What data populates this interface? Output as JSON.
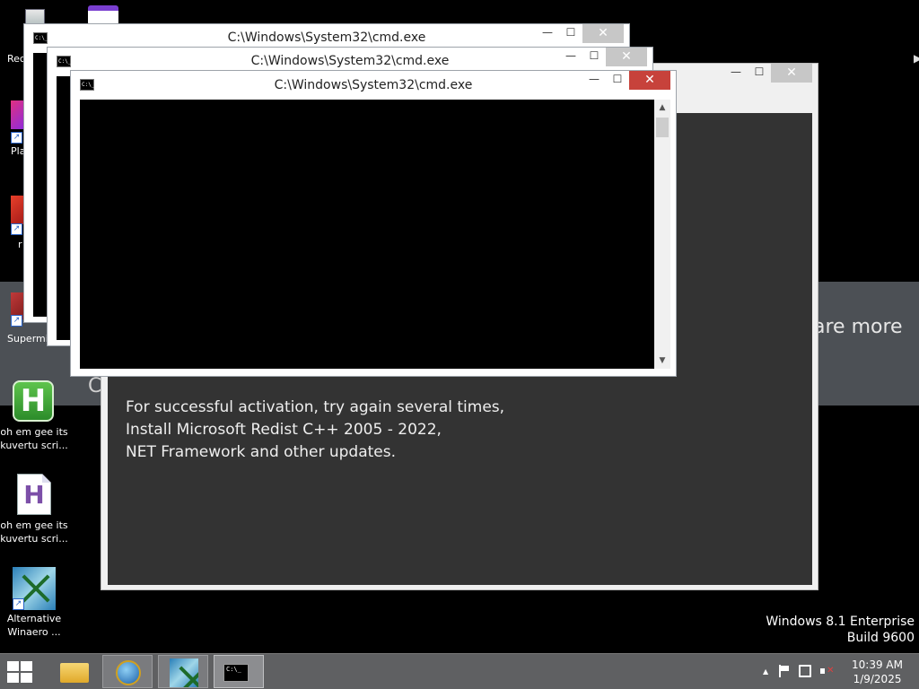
{
  "desktop": {
    "icons": [
      {
        "label": "Rec",
        "icon": "recycle-bin-icon"
      },
      {
        "label": "Pla",
        "icon": "app-shortcut-icon"
      },
      {
        "label": "r",
        "icon": "app-shortcut-icon"
      },
      {
        "label": "Supermi",
        "icon": "app-shortcut-icon"
      },
      {
        "label": "oh em gee its kuvertu scri...",
        "icon": "autohotkey-script-icon"
      },
      {
        "label": "oh em gee its kuvertu scri...",
        "icon": "script-file-icon"
      },
      {
        "label": "Alternative Winaero ...",
        "icon": "winaero-shortcut-icon"
      }
    ],
    "banner_text": "are more",
    "banner_partial": "C"
  },
  "activation_window": {
    "lines": [
      "For successful activation, try again several times,",
      "Install Microsoft Redist C++ 2005 - 2022,",
      "NET Framework and other updates."
    ],
    "background_color": "#333333"
  },
  "cmd_windows": [
    {
      "title": "C:\\Windows\\System32\\cmd.exe"
    },
    {
      "title": "C:\\Windows\\System32\\cmd.exe"
    },
    {
      "title": "C:\\Windows\\System32\\cmd.exe"
    }
  ],
  "window_controls": {
    "minimize": "—",
    "maximize": "☐",
    "close": "✕"
  },
  "watermark": {
    "line1": "Windows 8.1 Enterprise",
    "line2": "Build 9600"
  },
  "taskbar": {
    "items": [
      {
        "name": "file-explorer",
        "icon": "folder-icon"
      },
      {
        "name": "internet-browser",
        "icon": "browser-globe-icon"
      },
      {
        "name": "winaero-app",
        "icon": "winaero-icon"
      },
      {
        "name": "command-prompt",
        "icon": "cmd-icon",
        "active": true
      }
    ],
    "tray_up": "▲",
    "clock_time": "10:39 AM",
    "clock_date": "1/9/2025"
  },
  "colors": {
    "accent_close": "#c7423b",
    "taskbar": "#5f6062"
  }
}
